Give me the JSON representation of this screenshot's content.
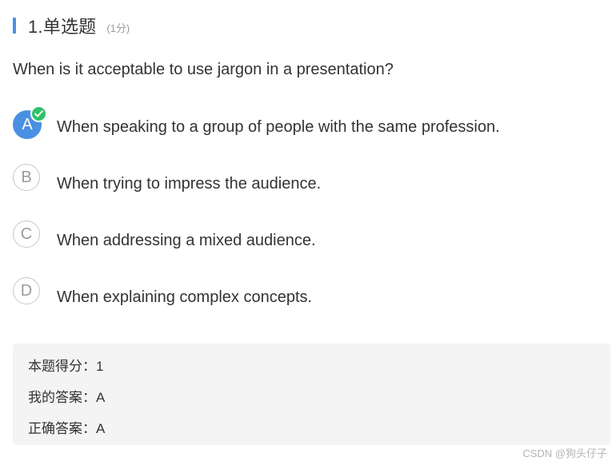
{
  "question": {
    "number_title": "1.单选题",
    "score_hint": "(1分)",
    "text": "When is it acceptable to use jargon in a presentation?"
  },
  "options": [
    {
      "letter": "A",
      "text": "When speaking to a group of people with the same profession.",
      "selected": true
    },
    {
      "letter": "B",
      "text": "When trying to impress the audience.",
      "selected": false
    },
    {
      "letter": "C",
      "text": "When addressing a mixed audience.",
      "selected": false
    },
    {
      "letter": "D",
      "text": "When explaining complex concepts.",
      "selected": false
    }
  ],
  "result": {
    "score_line": "本题得分：1",
    "my_answer_line": "我的答案：A",
    "correct_answer_line": "正确答案：A"
  },
  "watermark": "CSDN @狗头仔子",
  "colors": {
    "accent": "#4a90e2",
    "check": "#2ec26a",
    "result_bg": "#f4f4f4"
  },
  "icons": {
    "selected_mark": "check-icon"
  }
}
